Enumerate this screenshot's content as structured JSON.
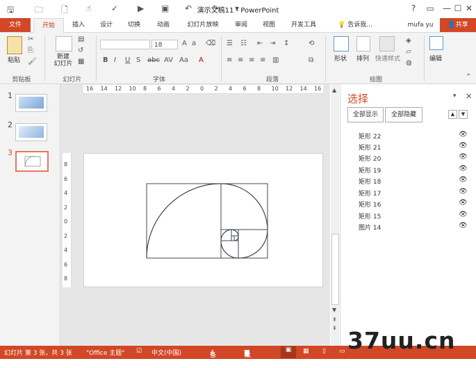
{
  "window": {
    "title": "演示文稿11 - PowerPoint",
    "help": "?"
  },
  "tabs": [
    "文件",
    "开始",
    "插入",
    "设计",
    "切换",
    "动画",
    "幻灯片放映",
    "审阅",
    "视图",
    "开发工具"
  ],
  "tell_me": "告诉我...",
  "user": "mufa yu",
  "share": "共享",
  "ribbon": {
    "groups": [
      "剪贴板",
      "幻灯片",
      "字体",
      "段落",
      "绘图"
    ],
    "paste": "粘贴",
    "new_slide": "新建\n幻灯片",
    "font_size": "18",
    "shape": "形状",
    "arrange": "排列",
    "quick_style": "快速样式",
    "edit": "编辑",
    "font_buttons": [
      "B",
      "I",
      "U",
      "S",
      "abc",
      "AV",
      "Aa",
      "A"
    ]
  },
  "thumbnails": [
    {
      "num": "1"
    },
    {
      "num": "2"
    },
    {
      "num": "3"
    }
  ],
  "ruler_h": [
    "16",
    "14",
    "12",
    "10",
    "8",
    "6",
    "4",
    "2",
    "0",
    "2",
    "4",
    "6",
    "8",
    "10",
    "12",
    "14",
    "16"
  ],
  "ruler_v": [
    "8",
    "6",
    "4",
    "2",
    "0",
    "2",
    "4",
    "6",
    "8"
  ],
  "pane": {
    "title": "选择",
    "show_all": "全部显示",
    "hide_all": "全部隐藏",
    "items": [
      "矩形 22",
      "矩形 21",
      "矩形 20",
      "矩形 19",
      "矩形 18",
      "矩形 17",
      "矩形 16",
      "矩形 15",
      "图片 14"
    ]
  },
  "status": {
    "slide_info": "幻灯片 第 3 张，共 3 张",
    "theme": "\"Office 主题\"",
    "lang": "中文(中国)",
    "notes": "备注",
    "comments": "批注"
  },
  "watermark": "37uu.cn",
  "colors": {
    "accent": "#d24726",
    "ribbon_bg": "#f3f3f3"
  }
}
